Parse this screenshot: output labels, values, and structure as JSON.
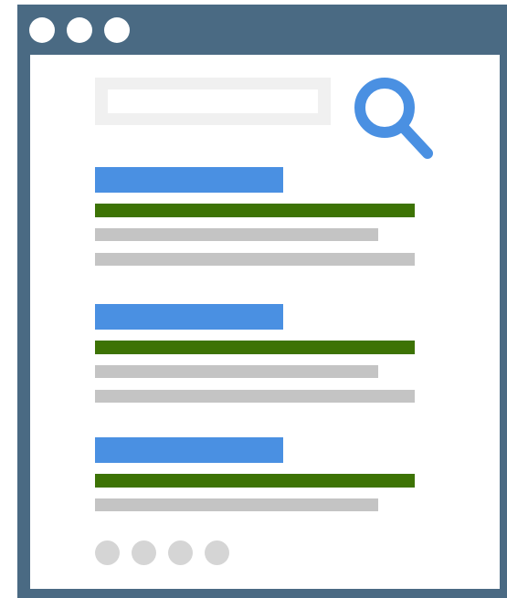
{
  "window": {
    "frame_color": "#4a6a83",
    "controls": [
      "window-dot",
      "window-dot",
      "window-dot"
    ]
  },
  "search": {
    "input_value": "",
    "icon": "search-icon",
    "icon_color": "#4a90e2"
  },
  "results": [
    {
      "title_color": "#4a90e2",
      "url_color": "#3d7305",
      "text_lines": 2
    },
    {
      "title_color": "#4a90e2",
      "url_color": "#3d7305",
      "text_lines": 2
    },
    {
      "title_color": "#4a90e2",
      "url_color": "#3d7305",
      "text_lines": 1
    }
  ],
  "pagination": {
    "page_count": 4,
    "dot_color": "#d5d5d5"
  }
}
